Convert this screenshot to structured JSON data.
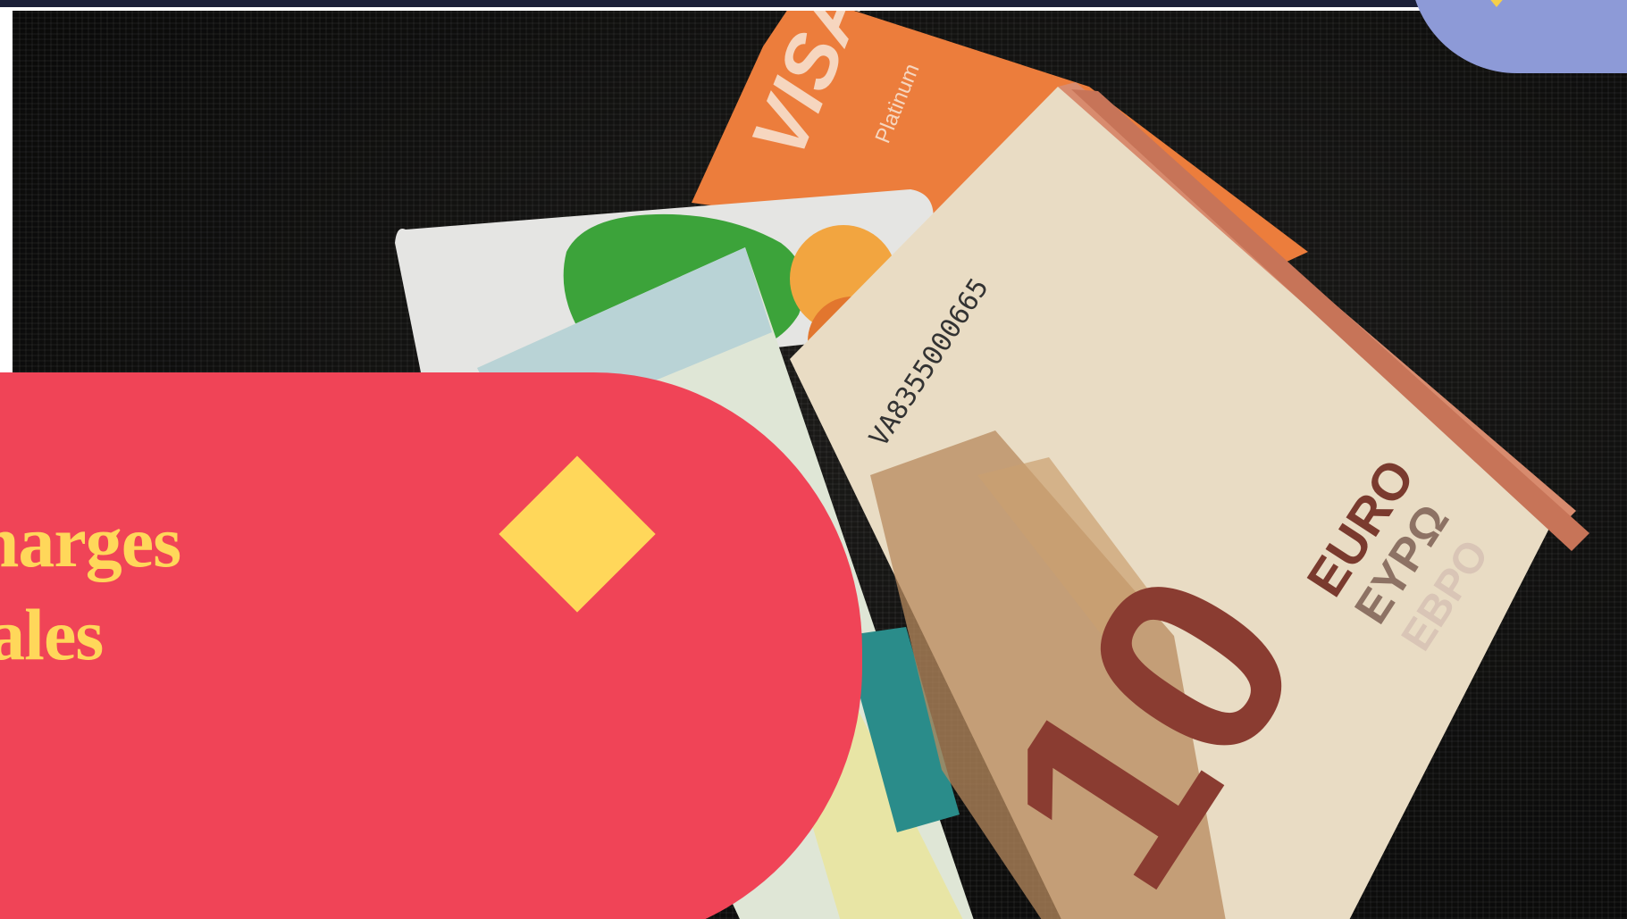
{
  "hero": {
    "title_lines": [
      "s charges",
      "ariales"
    ]
  },
  "photo": {
    "card_brand": "VISA",
    "card_tier": "Platinum",
    "banknote_serial": "VA8355000665",
    "banknote_currency_latin": "EURO",
    "banknote_currency_greek": "ΕΥΡΩ",
    "banknote_currency_cyrillic": "ЕВРО",
    "banknote_denomination": "10"
  },
  "colors": {
    "accent_red": "#f04457",
    "accent_yellow": "#ffd75a",
    "accent_blue": "#8d9ad7",
    "border_navy": "#1b2038"
  }
}
